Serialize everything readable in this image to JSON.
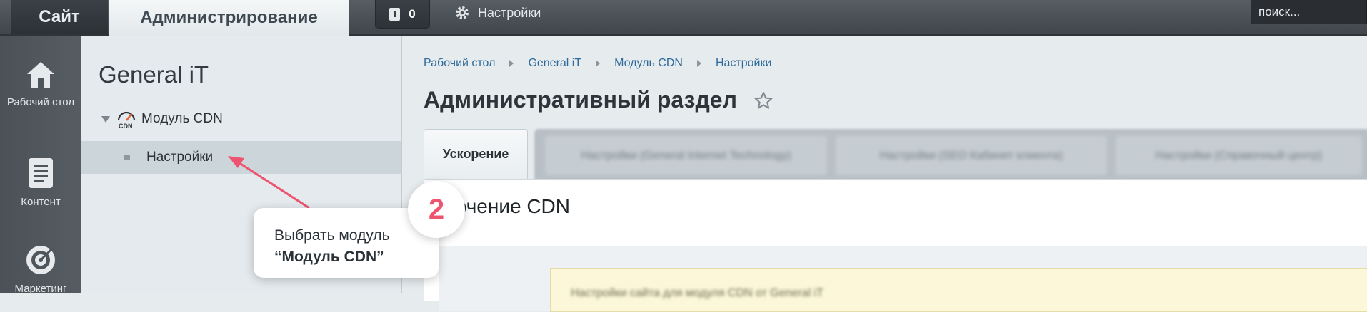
{
  "topbar": {
    "site_tab": "Сайт",
    "admin_tab": "Администрирование",
    "notifications_count": "0",
    "settings_label": "Настройки",
    "search_value": "поиск..."
  },
  "rail": {
    "items": [
      {
        "label": "Рабочий стол",
        "icon": "home-icon"
      },
      {
        "label": "Контент",
        "icon": "document-icon"
      },
      {
        "label": "Маркетинг",
        "icon": "target-icon"
      }
    ]
  },
  "tree": {
    "title": "General iT",
    "module_label": "Модуль CDN",
    "settings_label": "Настройки"
  },
  "breadcrumbs": [
    "Рабочий стол",
    "General iT",
    "Модуль CDN",
    "Настройки"
  ],
  "page_title": "Административный раздел",
  "tabs": {
    "active": "Ускорение",
    "blurred": [
      "Настройки (General Internet Technology)",
      "Настройки (SEO Кабинет клиента)",
      "Настройки (Справочный центр)"
    ]
  },
  "content": {
    "heading": "лючение CDN",
    "note": "Настройки сайта для модуля CDN от General iT"
  },
  "callout": {
    "step_number": "2",
    "line1": "Выбрать модуль",
    "line2": "“Модуль CDN”",
    "accent_color": "#ee5470"
  }
}
